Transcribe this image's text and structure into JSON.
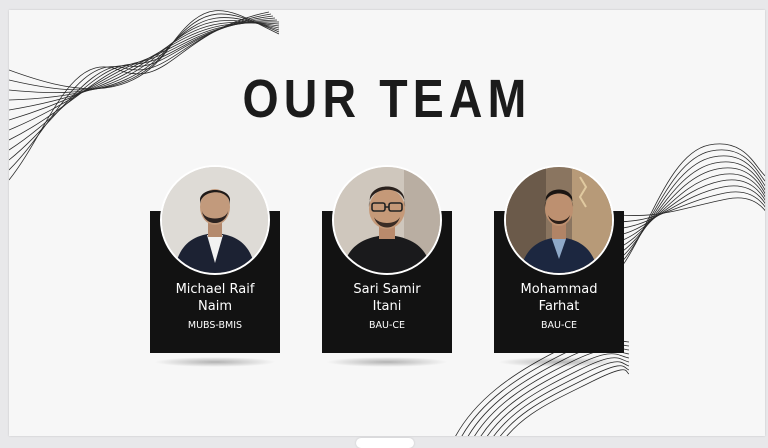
{
  "slide": {
    "title": "OUR TEAM",
    "members": [
      {
        "name_line1": "Michael Raif",
        "name_line2": "Naim",
        "affiliation": "MUBS-BMIS"
      },
      {
        "name_line1": "Sari Samir",
        "name_line2": "Itani",
        "affiliation": "BAU-CE"
      },
      {
        "name_line1": "Mohammad",
        "name_line2": "Farhat",
        "affiliation": "BAU-CE"
      }
    ]
  },
  "colors": {
    "card_background": "#121212",
    "title_text": "#1b1b1b",
    "slide_background": "#f7f7f7"
  }
}
